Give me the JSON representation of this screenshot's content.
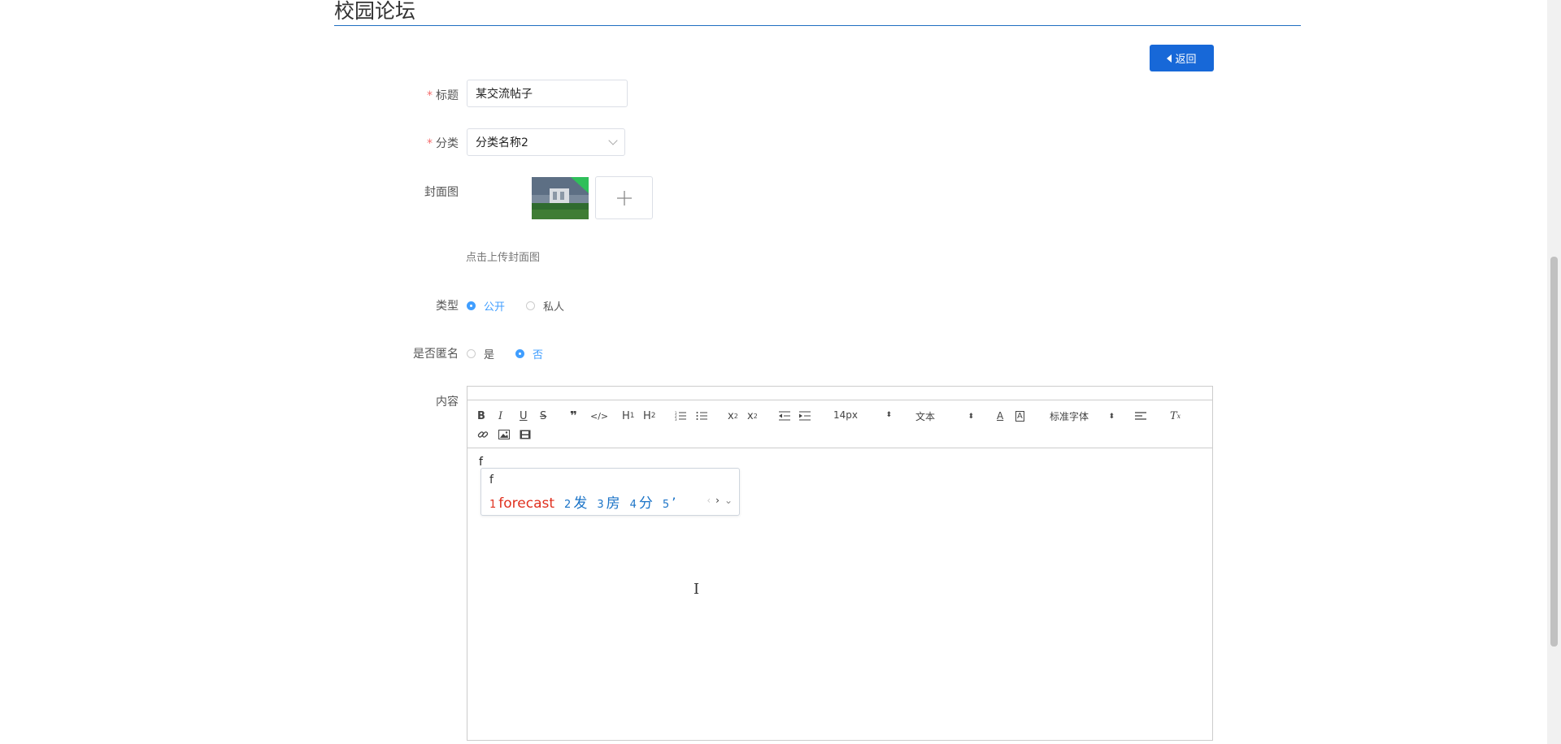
{
  "page": {
    "title": "校园论坛",
    "back_label": "返回"
  },
  "form": {
    "title_label": "标题",
    "title_value": "某交流帖子",
    "category_label": "分类",
    "category_value": "分类名称2",
    "cover_label": "封面图",
    "upload_hint": "点击上传封面图",
    "type_label": "类型",
    "type_options": [
      "公开",
      "私人"
    ],
    "type_selected": "公开",
    "anon_label": "是否匿名",
    "anon_options": [
      "是",
      "否"
    ],
    "anon_selected": "否",
    "content_label": "内容"
  },
  "editor": {
    "font_size": "14px",
    "text_style": "文本",
    "font_family": "标准字体",
    "typed": "f",
    "toolbar_buttons": [
      "B",
      "I",
      "U",
      "S",
      "quote",
      "code",
      "H1",
      "H2",
      "ordered-list",
      "bullet-list",
      "subscript",
      "superscript",
      "outdent",
      "indent",
      "text-color",
      "background-color",
      "align",
      "clear-format",
      "link",
      "image",
      "video"
    ]
  },
  "ime": {
    "input": "f",
    "candidates": [
      {
        "n": "1",
        "text": "forecast"
      },
      {
        "n": "2",
        "text": "发"
      },
      {
        "n": "3",
        "text": "房"
      },
      {
        "n": "4",
        "text": "分"
      },
      {
        "n": "5",
        "text": "’"
      }
    ]
  },
  "colors": {
    "primary": "#1768d8",
    "radio_active": "#409eff",
    "required": "#f56c6c",
    "title_line": "#1f6fc1"
  }
}
